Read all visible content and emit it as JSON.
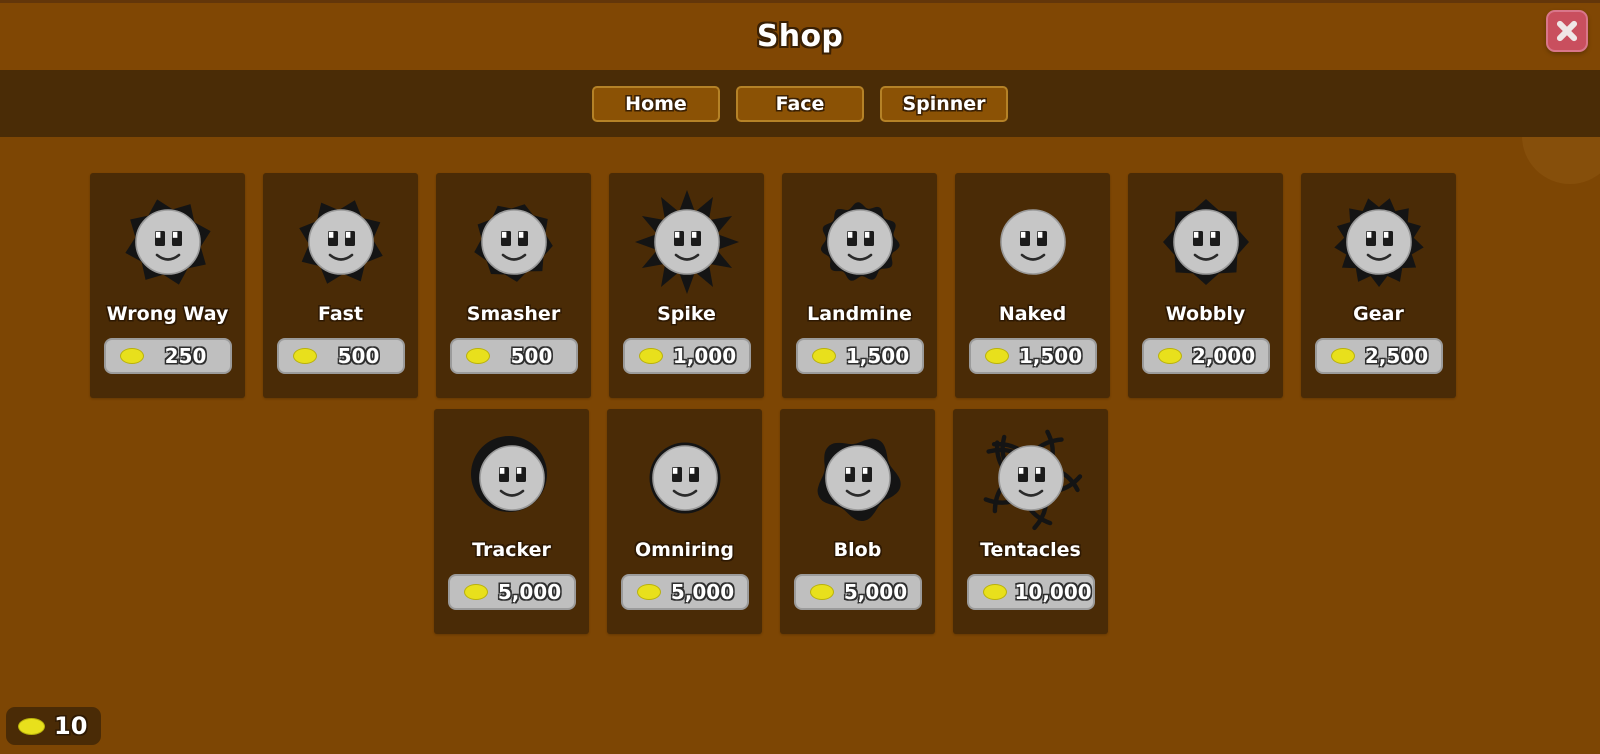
{
  "window": {
    "title": "Shop",
    "close_icon": "close-icon",
    "bg_color": "#7d4604",
    "header_color": "#804704",
    "navbar_color": "#4a2c06",
    "card_color": "#4a2b06",
    "close_button_color": "#c94f5e",
    "coin_color": "#e8e01c"
  },
  "nav": {
    "tabs": [
      {
        "label": "Home",
        "selected": true
      },
      {
        "label": "Face",
        "selected": false
      },
      {
        "label": "Spinner",
        "selected": false
      }
    ]
  },
  "shop": {
    "rows": [
      {
        "items": [
          {
            "name": "Wrong Way",
            "price": "250",
            "skin": "wrong-way",
            "coin_icon": "coin-icon"
          },
          {
            "name": "Fast",
            "price": "500",
            "skin": "fast",
            "coin_icon": "coin-icon"
          },
          {
            "name": "Smasher",
            "price": "500",
            "skin": "smasher",
            "coin_icon": "coin-icon"
          },
          {
            "name": "Spike",
            "price": "1,000",
            "skin": "spike",
            "coin_icon": "coin-icon"
          },
          {
            "name": "Landmine",
            "price": "1,500",
            "skin": "landmine",
            "coin_icon": "coin-icon"
          },
          {
            "name": "Naked",
            "price": "1,500",
            "skin": "naked",
            "coin_icon": "coin-icon"
          },
          {
            "name": "Wobbly",
            "price": "2,000",
            "skin": "wobbly",
            "coin_icon": "coin-icon"
          },
          {
            "name": "Gear",
            "price": "2,500",
            "skin": "gear",
            "coin_icon": "coin-icon"
          }
        ]
      },
      {
        "items": [
          {
            "name": "Tracker",
            "price": "5,000",
            "skin": "tracker",
            "coin_icon": "coin-icon"
          },
          {
            "name": "Omniring",
            "price": "5,000",
            "skin": "omniring",
            "coin_icon": "coin-icon"
          },
          {
            "name": "Blob",
            "price": "5,000",
            "skin": "blob",
            "coin_icon": "coin-icon"
          },
          {
            "name": "Tentacles",
            "price": "10,000",
            "skin": "tentacles",
            "coin_icon": "coin-icon"
          }
        ]
      }
    ]
  },
  "balance": {
    "amount": "10",
    "coin_icon": "coin-icon"
  }
}
